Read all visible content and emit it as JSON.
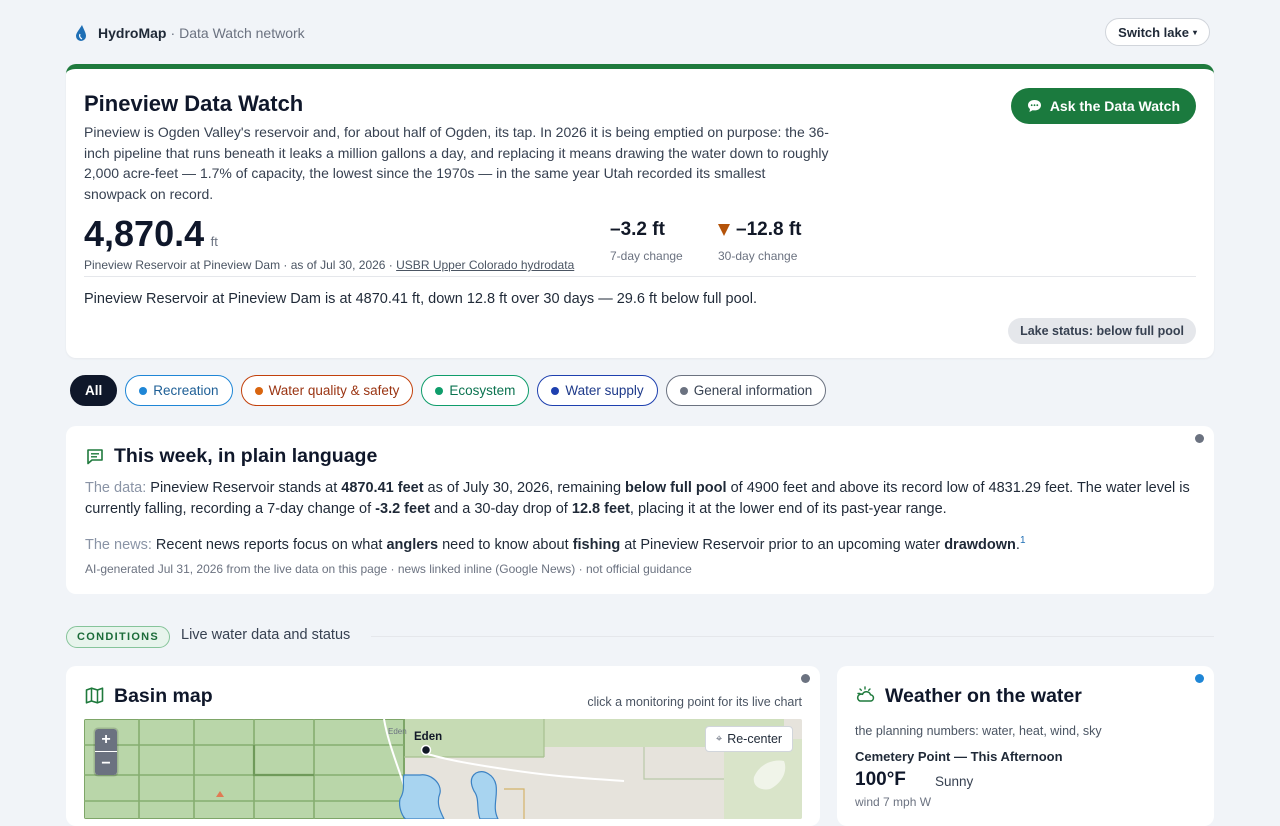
{
  "brand": {
    "name": "HydroMap",
    "separator": "·",
    "network": "Data Watch network"
  },
  "switch_lake": {
    "label": "Switch lake",
    "caret": "▾"
  },
  "hero": {
    "title": "Pineview Data Watch",
    "intro": "Pineview is Ogden Valley's reservoir and, for about half of Ogden, its tap. In 2026 it is being emptied on purpose: the 36-inch pipeline that runs beneath it leaks a million gallons a day, and replacing it means drawing the water down to roughly 2,000 acre-feet — 1.7% of capacity, the lowest since the 1970s — in the same year Utah recorded its smallest snowpack on record.",
    "ask_label": "Ask the Data Watch",
    "level_value": "4,870.4",
    "level_unit": "ft",
    "caption_text": "Pineview Reservoir at Pineview Dam · as of Jul 30, 2026 · ",
    "caption_source": "USBR Upper Colorado hydrodata",
    "change7_value": "–3.2 ft",
    "change7_label": "7-day change",
    "change30_value": "–12.8 ft",
    "change30_label": "30-day change",
    "summary": "Pineview Reservoir at Pineview Dam is at 4870.41 ft, down 12.8 ft over 30 days — 29.6 ft below full pool.",
    "status": "Lake status: below full pool"
  },
  "filters": [
    {
      "label": "All"
    },
    {
      "label": "Recreation",
      "color": "#1f86d6"
    },
    {
      "label": "Water quality & safety",
      "color": "#c2410c"
    },
    {
      "label": "Ecosystem",
      "color": "#0f9d6b"
    },
    {
      "label": "Water supply",
      "color": "#1e40af"
    },
    {
      "label": "General information",
      "color": "#6b7280"
    }
  ],
  "week": {
    "title": "This week, in plain language",
    "data_label": "The data:",
    "data_t1": " Pineview Reservoir stands at ",
    "data_b1": "4870.41 feet",
    "data_t2": " as of July 30, 2026, remaining ",
    "data_b2": "below full pool",
    "data_t3": " of 4900 feet and above its record low of 4831.29 feet. The water level is currently falling, recording a 7-day change of ",
    "data_b3": "-3.2 feet",
    "data_t4": " and a 30-day drop of ",
    "data_b4": "12.8 feet",
    "data_t5": ", placing it at the lower end of its past-year range.",
    "news_label": "The news:",
    "news_t1": " Recent news reports focus on what ",
    "news_b1": "anglers",
    "news_t2": " need to know about ",
    "news_b2": "fishing",
    "news_t3": " at Pineview Reservoir prior to an upcoming water ",
    "news_b3": "drawdown",
    "news_t4": ".",
    "news_ref": "1",
    "footer": "AI-generated Jul 31, 2026 from the live data on this page · news linked inline (Google News) · not official guidance"
  },
  "conditions": {
    "badge": "CONDITIONS",
    "text": "Live water data and status"
  },
  "map": {
    "title": "Basin map",
    "hint": "click a monitoring point for its live chart",
    "zoom_in": "+",
    "zoom_out": "−",
    "recenter": "Re-center",
    "recenter_icon": "⌖",
    "place_label": "Eden",
    "place_label_small": "Eden"
  },
  "weather": {
    "title": "Weather on the water",
    "sub": "the planning numbers: water, heat, wind, sky",
    "location": "Cemetery Point — This Afternoon",
    "temp": "100°F",
    "condition": "Sunny",
    "wind": "wind 7 mph W"
  },
  "colors": {
    "accent_green": "#1b7a3e",
    "drop_arrow": "#b45309",
    "lake_blue": "#a8d4f0"
  }
}
